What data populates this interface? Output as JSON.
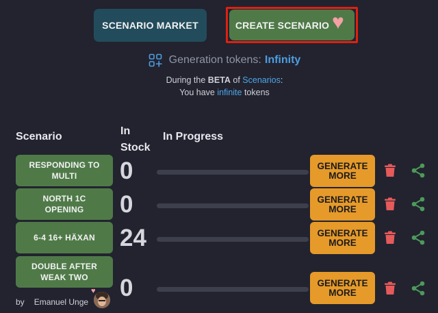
{
  "header": {
    "market_label": "SCENARIO MARKET",
    "create_label": "CREATE SCENARIO",
    "create_heart": "♥"
  },
  "tokens": {
    "label": "Generation tokens:",
    "value": "Infinity"
  },
  "beta": {
    "line1_prefix": "During the ",
    "line1_beta": "BETA",
    "line1_of": " of ",
    "line1_link": "Scenarios",
    "line1_suffix": ":",
    "line2_prefix": "You have ",
    "line2_accent": "infinite",
    "line2_suffix": " tokens"
  },
  "columns": {
    "scenario": "Scenario",
    "stock_line1": "In",
    "stock_line2": "Stock",
    "progress": "In Progress"
  },
  "rows": [
    {
      "name": "RESPONDING TO MULTI",
      "stock": "0",
      "generate_label": "GENERATE MORE",
      "progress": 0
    },
    {
      "name": "NORTH 1C OPENING",
      "stock": "0",
      "generate_label": "GENERATE MORE",
      "progress": 0
    },
    {
      "name": "6-4 16+ HÄXAN",
      "stock": "24",
      "generate_label": "GENERATE MORE",
      "progress": 0
    },
    {
      "name": "DOUBLE AFTER WEAK TWO",
      "stock": "0",
      "generate_label": "GENERATE MORE",
      "progress": 0
    }
  ],
  "byline": {
    "by": "by",
    "author": "Emanuel Unge"
  },
  "colors": {
    "background": "#22232f",
    "scenario_green": "#4f7a48",
    "generate_orange": "#e69a2a",
    "trash_red": "#e55a5a",
    "share_green": "#4c9a5a",
    "accent_blue": "#4ea6e8",
    "highlight_red": "#e02010"
  },
  "icons": {
    "tokens": "grid-plus-icon",
    "delete": "trash-icon",
    "share": "share-icon"
  }
}
